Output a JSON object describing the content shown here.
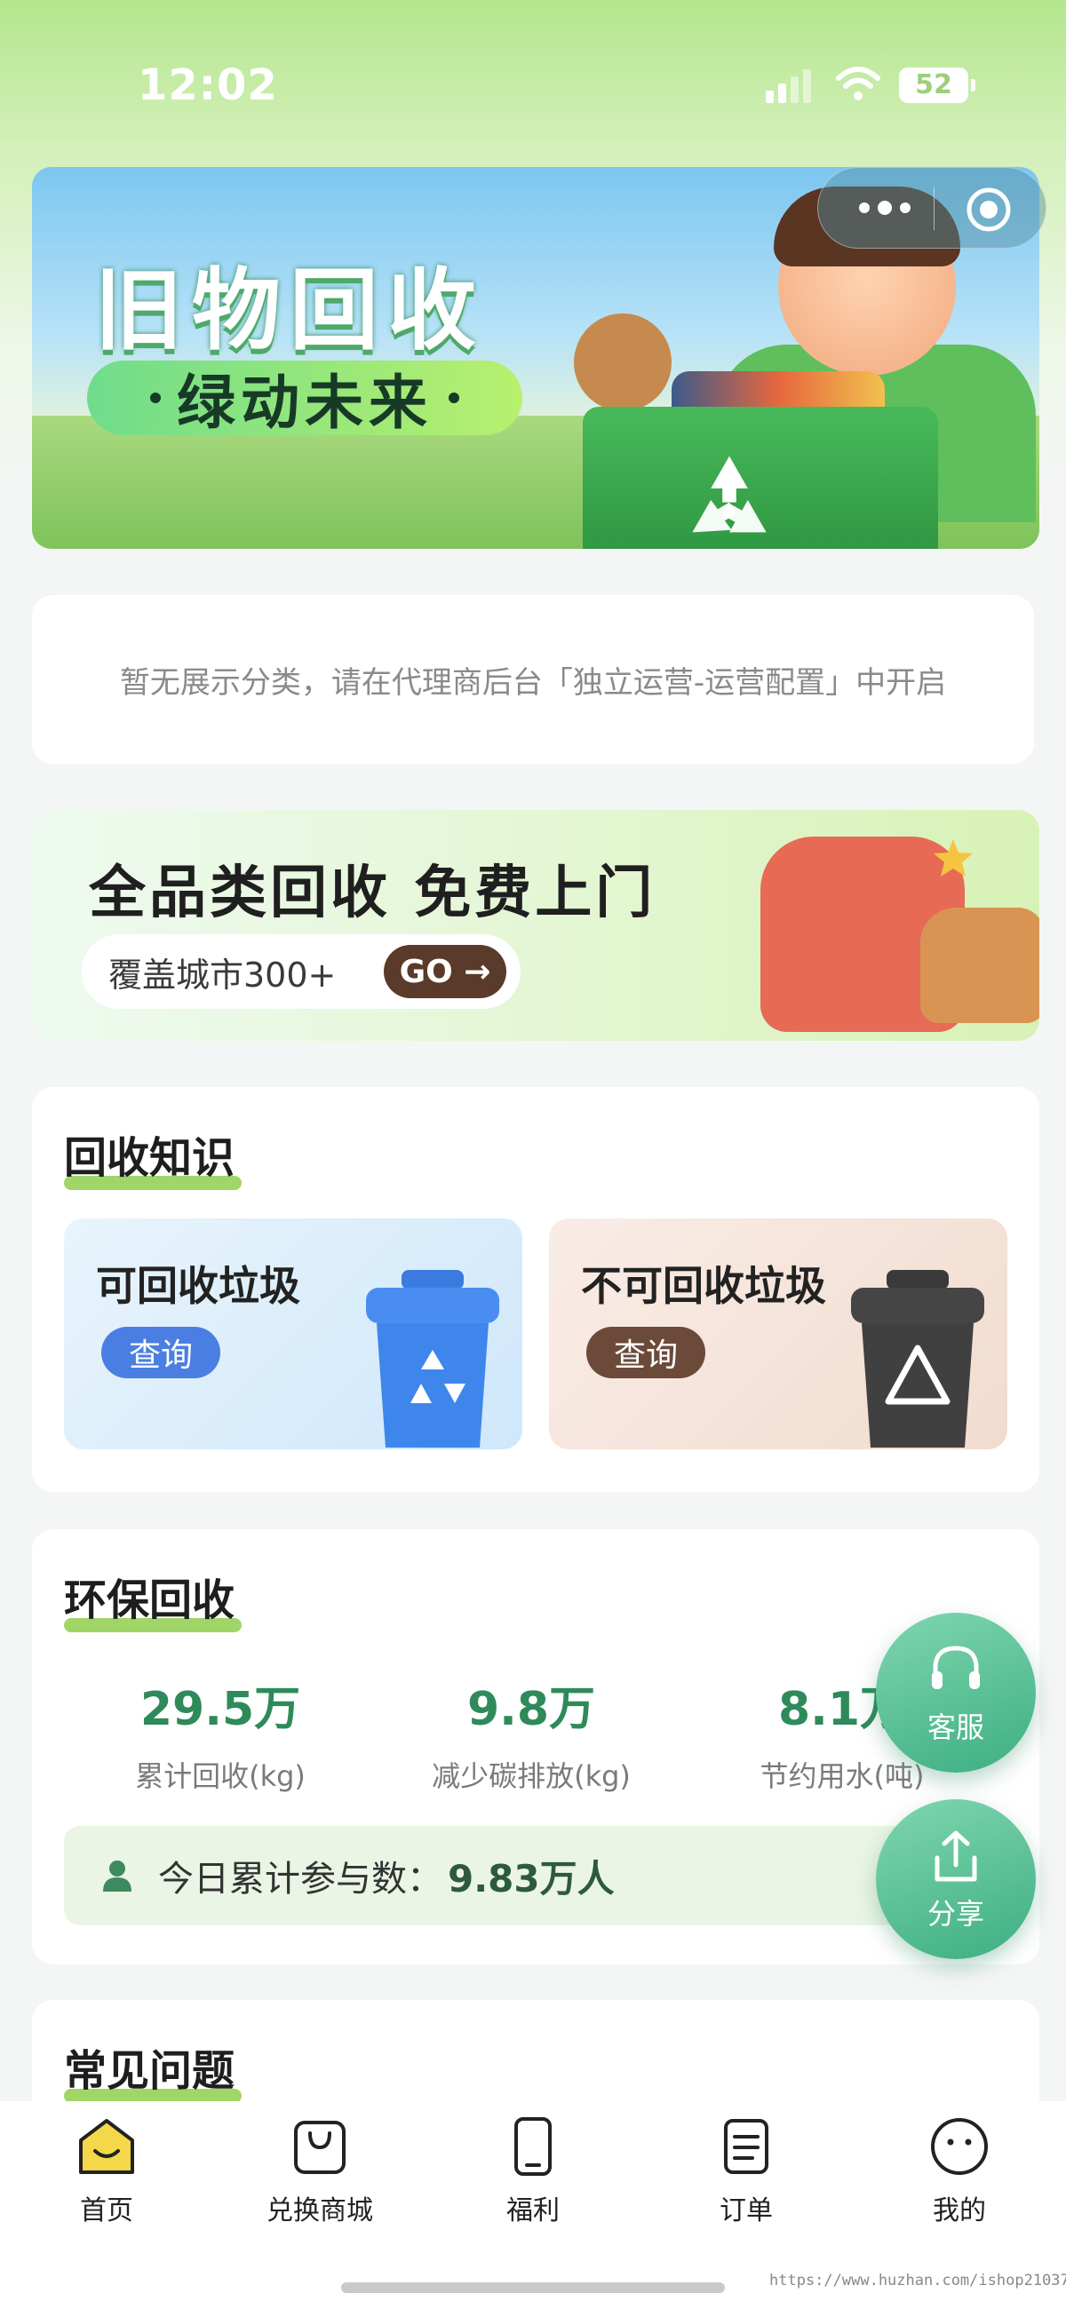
{
  "status_bar": {
    "time": "12:02",
    "battery": "52"
  },
  "banner": {
    "title": "旧物回收",
    "subtitle": "绿动未来"
  },
  "notice": {
    "text": "暂无展示分类，请在代理商后台「独立运营-运营配置」中开启"
  },
  "promo": {
    "title": "全品类回收  免费上门",
    "pill_text": "覆盖城市300+",
    "go_label": "GO"
  },
  "knowledge": {
    "title": "回收知识",
    "recyclable": {
      "title": "可回收垃圾",
      "button": "查询"
    },
    "non_recyclable": {
      "title": "不可回收垃圾",
      "button": "查询"
    }
  },
  "eco": {
    "title": "环保回收",
    "stats": [
      {
        "value": "29.5万",
        "label": "累计回收(kg)"
      },
      {
        "value": "9.8万",
        "label": "减少碳排放(kg)"
      },
      {
        "value": "8.1万",
        "label": "节约用水(吨)"
      }
    ],
    "participation_label": "今日累计参与数：",
    "participation_value": "9.83万人"
  },
  "faq": {
    "title": "常见问题"
  },
  "floating": {
    "service": "客服",
    "share": "分享"
  },
  "tabs": [
    {
      "label": "首页",
      "icon": "home-icon"
    },
    {
      "label": "兑换商城",
      "icon": "shopping-bag-icon"
    },
    {
      "label": "福利",
      "icon": "phone-icon"
    },
    {
      "label": "订单",
      "icon": "clipboard-icon"
    },
    {
      "label": "我的",
      "icon": "face-icon"
    }
  ],
  "watermark": "https://www.huzhan.com/ishop21037",
  "colors": {
    "accent_green": "#2f8a5a",
    "underline_green": "#8fcf4e",
    "float_green": "#3eae82",
    "home_yellow": "#f5d84a"
  }
}
